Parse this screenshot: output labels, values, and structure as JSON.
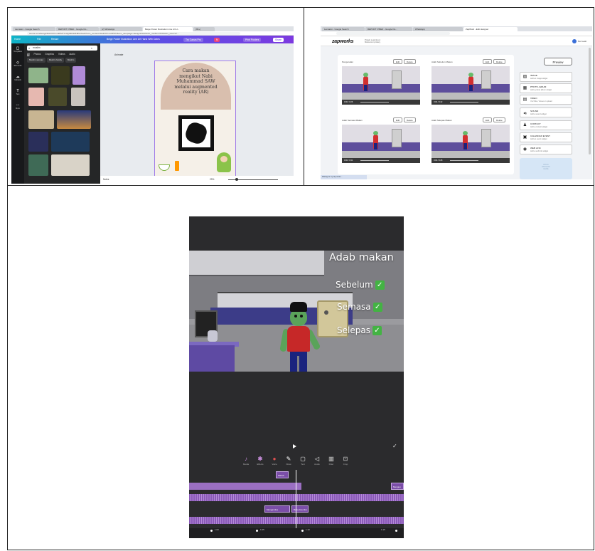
{
  "canva": {
    "browser_tabs": [
      "Lamaran - Google Search",
      "REPORT O'BED - Google Do...",
      "(2) WhatsApp",
      "Beige Poster Illustration Line Art H...",
      "(99+)"
    ],
    "url": "canva.com/design/DAFX0Yxm9PMY/C3Q33D30KMNr2/edit?utm_content=DAFX0Yxm9PMY&utm_campaign=designshare&utm_medium=link&utm_source=...",
    "menu": {
      "home": "Home",
      "file": "File",
      "resize": "Resize",
      "doc_title": "Beige Poster Illustration Line Art Hand With Dates",
      "try_pro": "Try Canva Pro",
      "avatar": "N",
      "print": "Print Posters",
      "share": "Share"
    },
    "rail": [
      "Templates",
      "Elements",
      "Uploads",
      "Text",
      "More"
    ],
    "search": {
      "value": "muslim"
    },
    "categories": [
      "All",
      "Photos",
      "Graphics",
      "Videos",
      "Audio"
    ],
    "chips": [
      "Muslim woman",
      "Muslim family",
      "Muslim"
    ],
    "animate": "Animate",
    "poster_title": "Cara makan\nmengikut Nabi\nMuhammad SAW\nmelalui augmented\nreality (AR)",
    "notes": "Notes",
    "zoom": "29%",
    "colors": {
      "accent": "#7d2ae8",
      "brand_start": "#0fb5c7"
    }
  },
  "zapworks": {
    "browser_tabs": [
      "Lamaran - Google Search",
      "REPORT O'BED - Google Do...",
      "WhatsApp",
      "ZapWork - Edit designer"
    ],
    "logo": "zapworks",
    "sub": [
      "Projek Learning A",
      "Mamaroni privacy"
    ],
    "user": "Nur Lesti",
    "preview": "Preview",
    "videos": [
      {
        "title": "Pengenalan",
        "time": "0:00 / 0:26"
      },
      {
        "title": "Adab Sebelum Makan",
        "time": "0:00 / 0:42"
      },
      {
        "title": "Adab Semasa Makan",
        "time": "0:00 / 0:31"
      },
      {
        "title": "Adab Selepas Makan",
        "time": "0:00 / 0:28"
      }
    ],
    "edit": "Edit",
    "delete": "Delete",
    "widgets": [
      {
        "label": "IMAGE",
        "desc": "Add an image widget",
        "icon": "image-icon",
        "glyph": "▨"
      },
      {
        "label": "PHOTO ALBUM",
        "desc": "Add a photo album widget",
        "icon": "album-icon",
        "glyph": "▦"
      },
      {
        "label": "VIDEO",
        "desc": "YouTube, Vimeo or upload",
        "icon": "video-icon",
        "glyph": "▤"
      },
      {
        "label": "SOUND",
        "desc": "Add a sound widget",
        "icon": "sound-icon",
        "glyph": "◀)"
      },
      {
        "label": "CONTACT",
        "desc": "Add a contact widget",
        "icon": "contact-icon",
        "glyph": "♟"
      },
      {
        "label": "CALENDAR EVENT",
        "desc": "Add an event widget",
        "icon": "calendar-icon",
        "glyph": "▣"
      },
      {
        "label": "WEB LINK",
        "desc": "Add a web link widget",
        "icon": "globe-icon",
        "glyph": "◉"
      }
    ],
    "drop": "DRAG\nWIDGETS\nHERE",
    "status": "Waiting for my.zap.works..."
  },
  "editor": {
    "overlay_title": "Adab makan",
    "items": [
      "Sebelum",
      "Semasa",
      "Selepas"
    ],
    "check_glyph": "✓",
    "tools": [
      "Media",
      "Effects",
      "Voice",
      "Draw",
      "Text",
      "Audio",
      "Filter",
      "Crop"
    ],
    "clips": [
      "Masuk",
      "Mengun",
      "Mengai (3s)",
      "Baca doa (3s)"
    ],
    "timeline_labels": [
      "1:00",
      "1:05",
      "1:10",
      "1:15"
    ]
  }
}
